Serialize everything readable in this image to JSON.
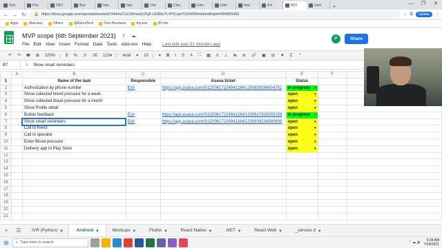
{
  "browser": {
    "tabs": [
      "Goo",
      "Pos",
      "DEV",
      "Buz",
      "hea",
      "hea",
      "Che",
      "Clou",
      "Usin",
      "Usin",
      "how",
      "A b",
      "MVI",
      "User"
    ],
    "active_tab_index": 12,
    "new_tab": "+",
    "window_controls": [
      "—",
      "❐",
      "✕"
    ],
    "nav": [
      "←",
      "→",
      "↻"
    ],
    "url": "https://docs.google.com/spreadsheets/d/1hhHnZ7uCWmwZz21j8-LE0MzTL4YiCuwYOtXWWmkt/edit#gid=494855462",
    "update_label": "Update",
    "bookmarks": [
      "Apps",
      "Start-day",
      "Others",
      "@RahulTech",
      "Own Business",
      "Access",
      "30 min"
    ]
  },
  "doc": {
    "title": "MVP scope (6th September 2021)",
    "title_icons": "☆ ⇪ ☁",
    "menus": [
      "File",
      "Edit",
      "View",
      "Insert",
      "Format",
      "Data",
      "Tools",
      "Add-ons",
      "Help"
    ],
    "last_edit": "Last edit was 31 minutes ago",
    "avatar_letter": "P",
    "share_label": "Share"
  },
  "toolbar": {
    "items": [
      "↶",
      "↷",
      "🖶",
      "⊞",
      "100%",
      "$",
      "%",
      ".0",
      ".00",
      "123▾",
      "Arial",
      "▾",
      "10",
      "▾",
      "B",
      "I",
      "S",
      "A",
      "⛶",
      "▦",
      "≡",
      "⊥",
      "↹",
      "⊘",
      "🔗",
      "▣",
      "⊟",
      "▼",
      "Σ",
      "⌃"
    ]
  },
  "formula": {
    "cell_ref": "B7",
    "fx": "fx",
    "value": "Show smart reminders"
  },
  "columns": [
    "",
    "A",
    "B",
    "C",
    "D",
    "E",
    "F",
    "G"
  ],
  "header_row": {
    "num": "1",
    "a": "",
    "b": "Name of the task",
    "c": "Responsible",
    "d": "Asana ticket",
    "e": "Status",
    "f": ""
  },
  "rows": [
    {
      "num": "2",
      "b": "Authorization by phone number",
      "c": "Erin",
      "d": "https://app.asana.com/0/1200617224941184/1200638086604752",
      "e": "in progress"
    },
    {
      "num": "3",
      "b": "Show collected blood pressure for a week",
      "c": "",
      "d": "",
      "e": "open"
    },
    {
      "num": "4",
      "b": "Show collected blood pressure for a month",
      "c": "",
      "d": "",
      "e": "open"
    },
    {
      "num": "5",
      "b": "Show Profile detail",
      "c": "",
      "d": "",
      "e": "open"
    },
    {
      "num": "6",
      "b": "Button feedback",
      "c": "Erin",
      "d": "https://app.asana.com/0/1200617224941184/1200617828005159",
      "e": "in progress"
    },
    {
      "num": "7",
      "b": "Show smart reminders",
      "c": "Erin",
      "d": "https://app.asana.com/0/1200617224941184/1200638134580809",
      "e": "open"
    },
    {
      "num": "8",
      "b": "Call to friend",
      "c": "",
      "d": "",
      "e": "open"
    },
    {
      "num": "9",
      "b": "Call to operator",
      "c": "",
      "d": "",
      "e": "open"
    },
    {
      "num": "10",
      "b": "Enter Blood pressure",
      "c": "",
      "d": "",
      "e": "open"
    },
    {
      "num": "11",
      "b": "Delivery app to Play Store",
      "c": "",
      "d": "",
      "e": "open"
    },
    {
      "num": "12",
      "b": "",
      "c": "",
      "d": "",
      "e": ""
    },
    {
      "num": "13",
      "b": "",
      "c": "",
      "d": "",
      "e": ""
    },
    {
      "num": "14",
      "b": "",
      "c": "",
      "d": "",
      "e": ""
    },
    {
      "num": "15",
      "b": "",
      "c": "",
      "d": "",
      "e": ""
    },
    {
      "num": "16",
      "b": "",
      "c": "",
      "d": "",
      "e": ""
    },
    {
      "num": "17",
      "b": "",
      "c": "",
      "d": "",
      "e": ""
    },
    {
      "num": "18",
      "b": "",
      "c": "",
      "d": "",
      "e": ""
    },
    {
      "num": "19",
      "b": "",
      "c": "",
      "d": "",
      "e": ""
    },
    {
      "num": "20",
      "b": "",
      "c": "",
      "d": "",
      "e": ""
    },
    {
      "num": "21",
      "b": "",
      "c": "",
      "d": "",
      "e": ""
    }
  ],
  "status_colors": {
    "in progress": "#00ff00",
    "open": "#ffff00"
  },
  "sheet_tabs": {
    "add": "+",
    "list": "☰",
    "tabs": [
      "IVR (Python)",
      "Android",
      "Mockups",
      "Flutter",
      "React Native",
      ".NET",
      "React Web",
      "_service d"
    ],
    "active": "Android",
    "dropdown": "▾"
  },
  "taskbar": {
    "start": "⊞",
    "search_placeholder": "Type here to search",
    "time": "9:28 AM",
    "date": "7/24/2021"
  }
}
